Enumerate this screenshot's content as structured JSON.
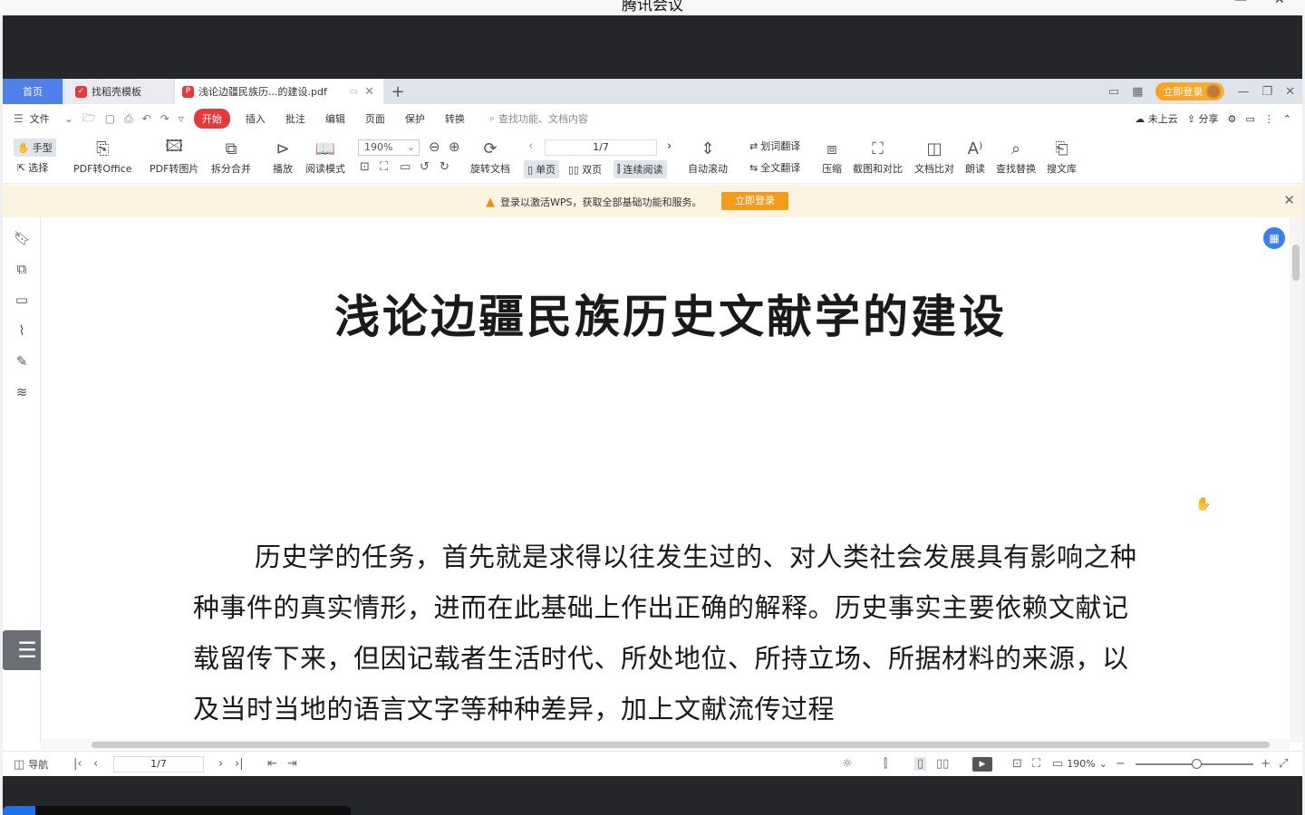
{
  "outer": {
    "title": "腾讯会议",
    "min": "—",
    "close": "✕"
  },
  "tabs": {
    "home": "首页",
    "daoke": "找稻壳模板",
    "pdf": "浅论边疆民族历...的建设.pdf",
    "add": "+"
  },
  "tabbar_right": {
    "login": "立即登录"
  },
  "menu": {
    "file": "文件",
    "items": [
      "开始",
      "插入",
      "批注",
      "编辑",
      "页面",
      "保护",
      "转换"
    ],
    "search": "查找功能、文档内容",
    "cloud": "未上云",
    "share": "分享"
  },
  "ribbon": {
    "hand": "手型",
    "select": "选择",
    "pdf_office": "PDF转Office",
    "pdf_image": "PDF转图片",
    "split_merge": "拆分合并",
    "play": "播放",
    "read_mode": "阅读模式",
    "zoom": "190%",
    "rotate": "旋转文档",
    "page": "1/7",
    "single": "单页",
    "double": "双页",
    "continuous": "连续阅读",
    "auto_scroll": "自动滚动",
    "word_translate": "划词翻译",
    "full_translate": "全文翻译",
    "compress": "压缩",
    "screenshot": "截图和对比",
    "compare": "文档比对",
    "read_aloud": "朗读",
    "find_replace": "查找替换",
    "library": "搜文库"
  },
  "notice": {
    "message": "登录以激活WPS，获取全部基础功能和服务。",
    "button": "立即登录"
  },
  "document": {
    "title": "浅论边疆民族历史文献学的建设",
    "paragraph": "历史学的任务，首先就是求得以往发生过的、对人类社会发展具有影响之种种事件的真实情形，进而在此基础上作出正确的解释。历史事实主要依赖文献记载留传下来，但因记载者生活时代、所处地位、所持立场、所据材料的来源，以及当时当地的语言文字等种种差异，加上文献流传过程"
  },
  "status": {
    "nav": "导航",
    "page": "1/7",
    "zoom": "190%"
  }
}
